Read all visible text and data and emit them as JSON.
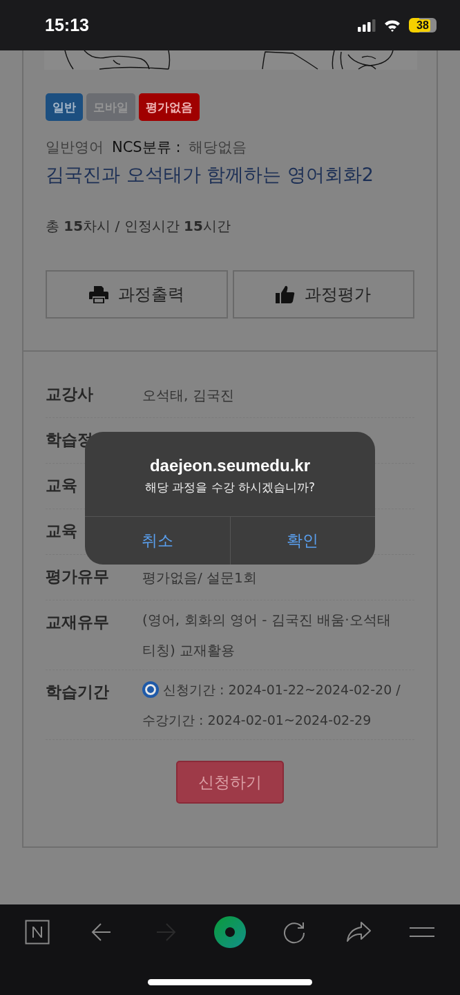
{
  "status_bar": {
    "time": "15:13",
    "battery": "38"
  },
  "course": {
    "badges": [
      {
        "label": "일반",
        "color": "#1c4f80"
      },
      {
        "label": "모바일",
        "color": "#6b6d72"
      },
      {
        "label": "평가없음",
        "color": "#a00000"
      }
    ],
    "category": "일반영어",
    "ncs_label": "NCS분류 :",
    "ncs_value": "해당없음",
    "title": "김국진과 오석태가 함께하는 영어회화2",
    "summary": "총 **15**차시 / 인정시간 **15**시간",
    "buttons": [
      {
        "kind": "print",
        "label": "과정출력"
      },
      {
        "kind": "like",
        "label": "과정평가"
      }
    ],
    "info": [
      {
        "label": "교강사",
        "value": "오석태, 김국진"
      },
      {
        "label": "학습정"
      },
      {
        "label": "교육"
      },
      {
        "label": "교육"
      },
      {
        "label": "평가유무",
        "value": "평가없음/ 설문1회"
      },
      {
        "label": "교재유무",
        "value": "(영어, 회화의 영어 - 김국진 배움·오석태 티칭) 교재활용"
      },
      {
        "label": "학습기간",
        "lines": [
          "신청기간 : 2024-01-22~2024-02-20 /",
          "수강기간 : 2024-02-01~2024-02-29"
        ],
        "radio": {
          "selected": true
        }
      }
    ],
    "apply": "신청하기"
  },
  "dialog": {
    "title": "daejeon.seumedu.kr",
    "message": "해당 과정을 수강 하시겠습니까?",
    "buttons": [
      {
        "label": "취소"
      },
      {
        "label": "확인"
      }
    ]
  },
  "toolbar": [
    {
      "kind": "home",
      "disabled": false
    },
    {
      "kind": "back",
      "disabled": false
    },
    {
      "kind": "forward",
      "disabled": true
    },
    {
      "kind": "green",
      "disabled": false
    },
    {
      "kind": "reload",
      "disabled": false
    },
    {
      "kind": "share",
      "disabled": false
    },
    {
      "kind": "menu",
      "disabled": false
    }
  ]
}
